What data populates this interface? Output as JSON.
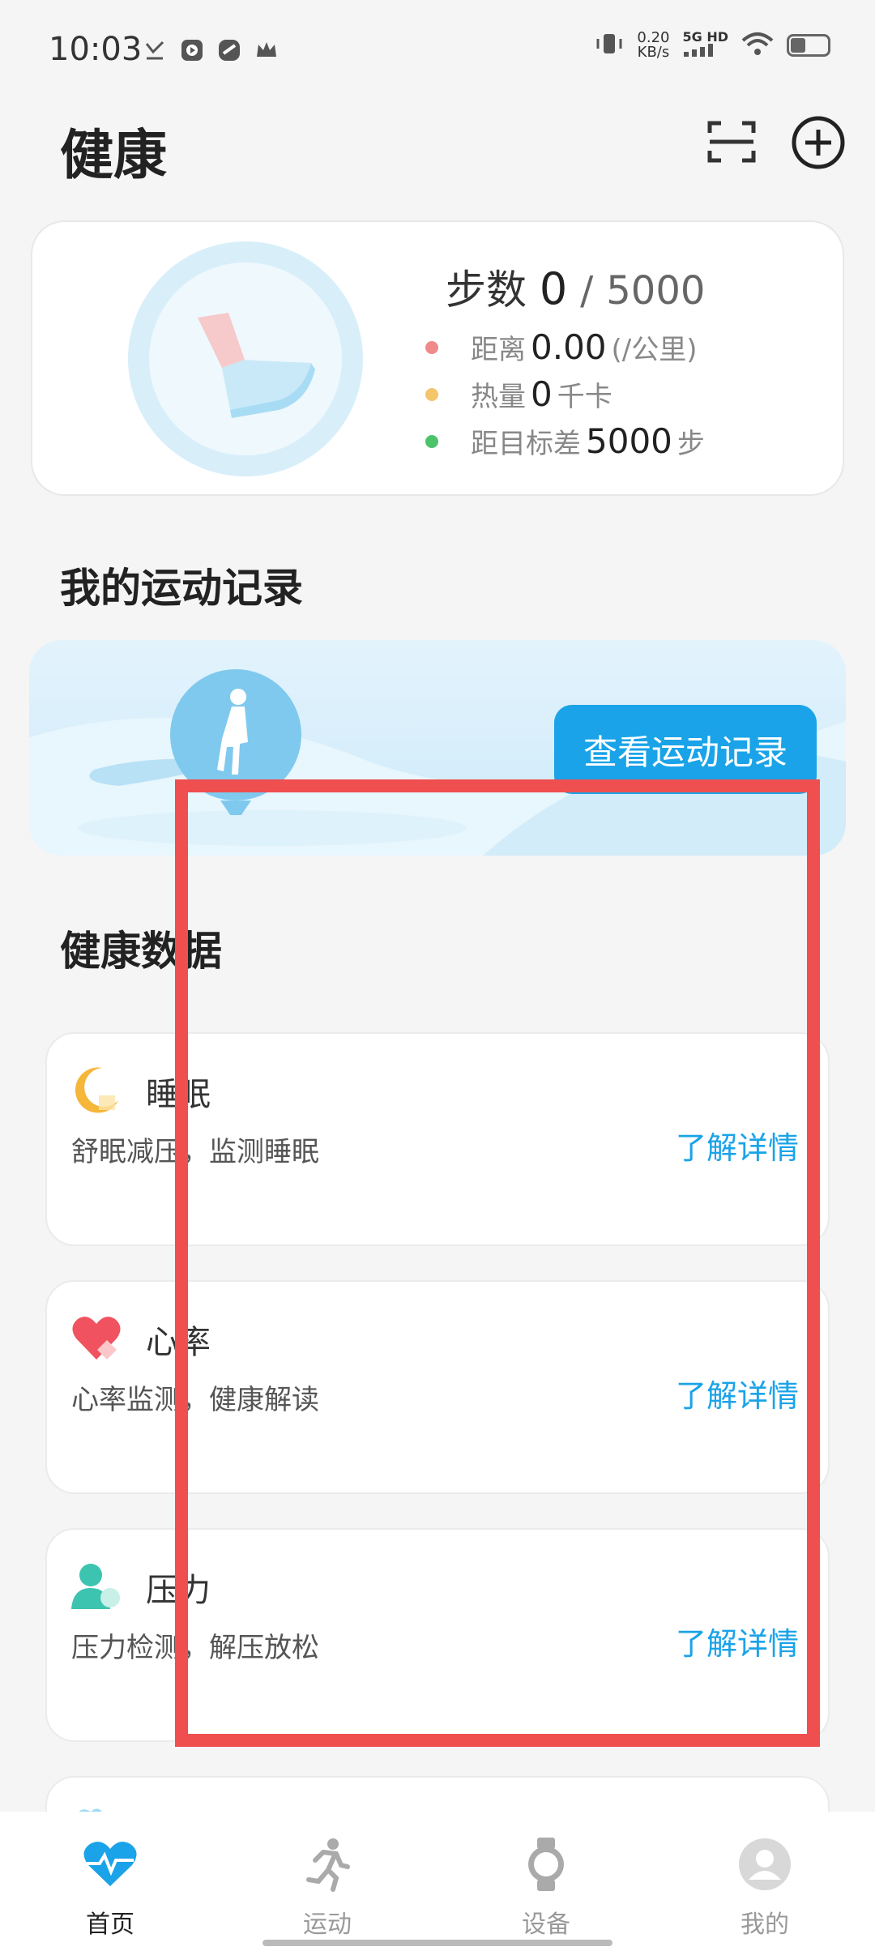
{
  "status_bar": {
    "time": "10:03",
    "speed_value": "0.20",
    "speed_unit": "KB/s",
    "network": "5G HD"
  },
  "header": {
    "title": "健康"
  },
  "steps": {
    "label": "步数",
    "value": "0",
    "separator": "/",
    "goal": "5000",
    "stats": [
      {
        "label": "距离",
        "value": "0.00",
        "unit": "(/公里)",
        "color": "#f08a8a"
      },
      {
        "label": "热量",
        "value": "0",
        "unit": "千卡",
        "color": "#f5c56b"
      },
      {
        "label": "距目标差",
        "value": "5000",
        "unit": "步",
        "color": "#4cc26a"
      }
    ]
  },
  "exercise": {
    "section_title": "我的运动记录",
    "button_label": "查看运动记录"
  },
  "health": {
    "section_title": "健康数据",
    "items": [
      {
        "name": "睡眠",
        "desc": "舒眠减压，监测睡眠",
        "link": "了解详情"
      },
      {
        "name": "心率",
        "desc": "心率监测，健康解读",
        "link": "了解详情"
      },
      {
        "name": "压力",
        "desc": "压力检测，解压放松",
        "link": "了解详情"
      }
    ]
  },
  "bottom_nav": {
    "items": [
      {
        "label": "首页"
      },
      {
        "label": "运动"
      },
      {
        "label": "设备"
      },
      {
        "label": "我的"
      }
    ]
  },
  "colors": {
    "accent": "#1aa3e8",
    "highlight": "#ef4f4f"
  }
}
